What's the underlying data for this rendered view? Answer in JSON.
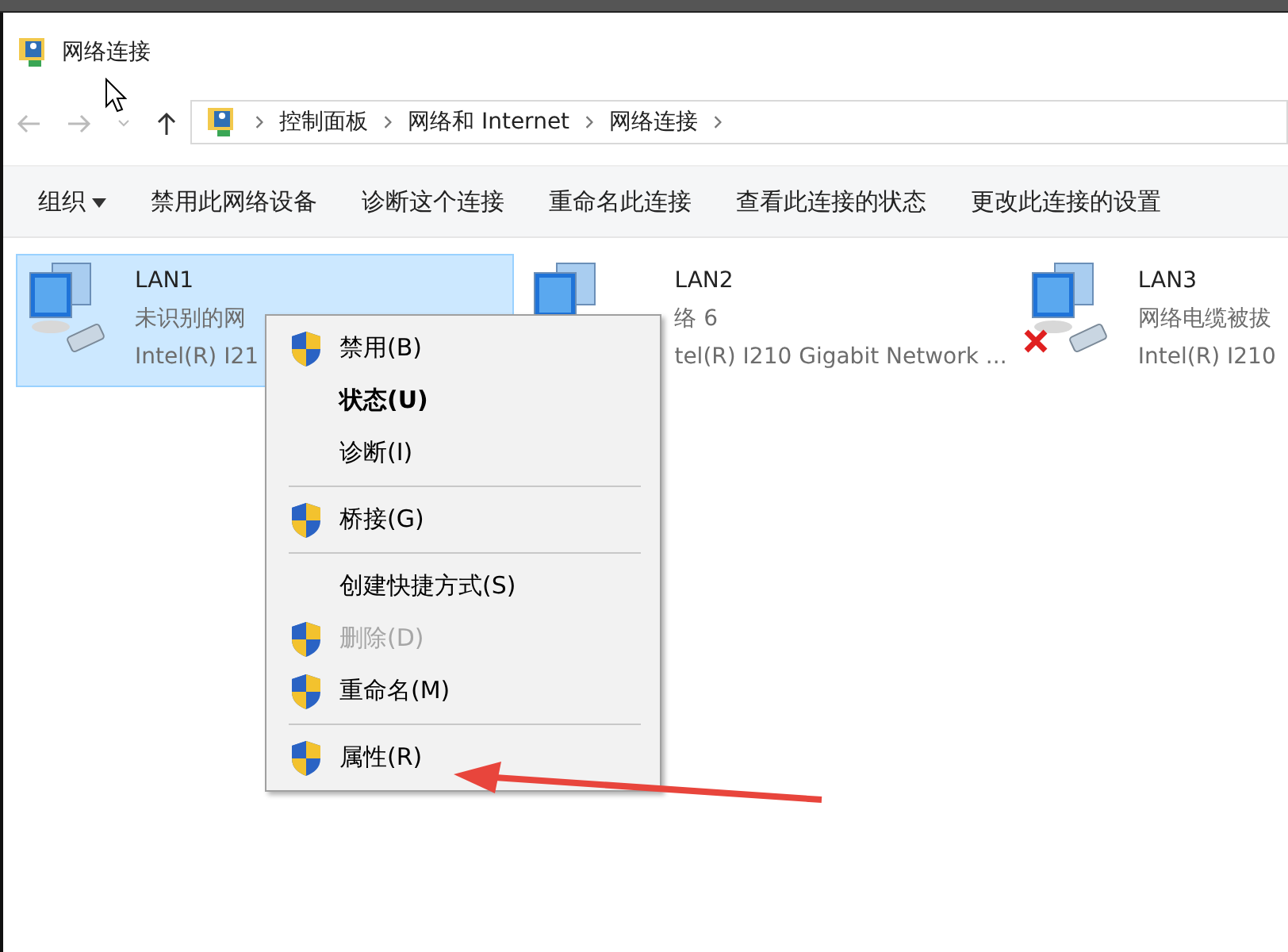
{
  "window": {
    "title": "网络连接"
  },
  "address": {
    "path": [
      "控制面板",
      "网络和 Internet",
      "网络连接"
    ]
  },
  "toolbar": [
    {
      "label": "组织",
      "dropdown": true
    },
    {
      "label": "禁用此网络设备",
      "dropdown": false
    },
    {
      "label": "诊断这个连接",
      "dropdown": false
    },
    {
      "label": "重命名此连接",
      "dropdown": false
    },
    {
      "label": "查看此连接的状态",
      "dropdown": false
    },
    {
      "label": "更改此连接的设置",
      "dropdown": false
    }
  ],
  "connections": [
    {
      "name": "LAN1",
      "status": "未识别的网",
      "device": "Intel(R) I21",
      "selected": true,
      "disconnected": false
    },
    {
      "name": "LAN2",
      "status": "络 6",
      "device": "tel(R) I210 Gigabit Network ...",
      "selected": false,
      "disconnected": false
    },
    {
      "name": "LAN3",
      "status": "网络电缆被拔",
      "device": "Intel(R) I210",
      "selected": false,
      "disconnected": true
    }
  ],
  "context_menu": [
    {
      "kind": "item",
      "label": "禁用(B)",
      "shield": true,
      "default": false,
      "disabled": false
    },
    {
      "kind": "item",
      "label": "状态(U)",
      "shield": false,
      "default": true,
      "disabled": false
    },
    {
      "kind": "item",
      "label": "诊断(I)",
      "shield": false,
      "default": false,
      "disabled": false
    },
    {
      "kind": "separator"
    },
    {
      "kind": "item",
      "label": "桥接(G)",
      "shield": true,
      "default": false,
      "disabled": false
    },
    {
      "kind": "separator"
    },
    {
      "kind": "item",
      "label": "创建快捷方式(S)",
      "shield": false,
      "default": false,
      "disabled": false
    },
    {
      "kind": "item",
      "label": "删除(D)",
      "shield": true,
      "default": false,
      "disabled": true
    },
    {
      "kind": "item",
      "label": "重命名(M)",
      "shield": true,
      "default": false,
      "disabled": false
    },
    {
      "kind": "separator"
    },
    {
      "kind": "item",
      "label": "属性(R)",
      "shield": true,
      "default": false,
      "disabled": false
    }
  ]
}
